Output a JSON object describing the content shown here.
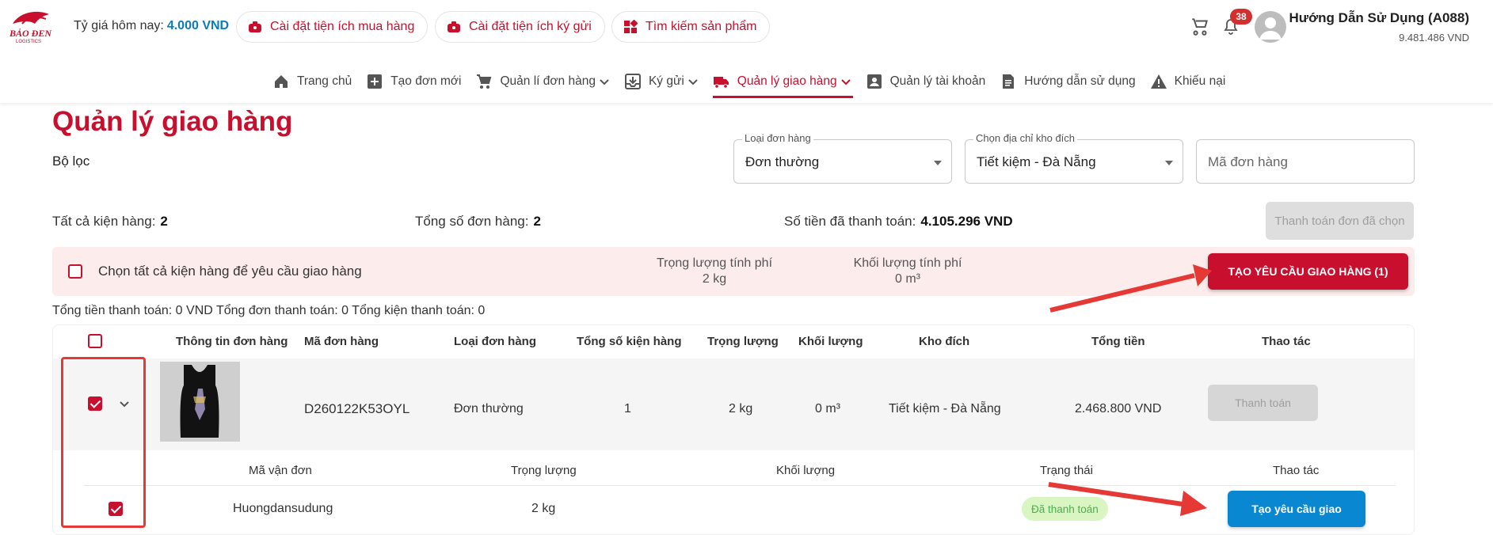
{
  "header": {
    "rate_label": "Tỷ giá hôm nay:",
    "rate_value": "4.000 VND",
    "pills": [
      {
        "label": "Cài đặt tiện ích mua hàng"
      },
      {
        "label": "Cài đặt tiện ích ký gửi"
      },
      {
        "label": "Tìm kiếm sản phẩm"
      }
    ],
    "notification_count": "38",
    "user_name": "Hướng Dẫn Sử Dụng (A088)",
    "user_balance": "9.481.486 VND"
  },
  "nav": [
    {
      "label": "Trang chủ",
      "icon": "home-icon"
    },
    {
      "label": "Tạo đơn mới",
      "icon": "plus-box-icon"
    },
    {
      "label": "Quản lí đơn hàng",
      "icon": "cart-icon"
    },
    {
      "label": "Ký gửi",
      "icon": "inbox-icon"
    },
    {
      "label": "Quản lý giao hàng",
      "icon": "truck-icon",
      "active": true
    },
    {
      "label": "Quản lý tài khoản",
      "icon": "account-box-icon"
    },
    {
      "label": "Hướng dẫn sử dụng",
      "icon": "document-icon"
    },
    {
      "label": "Khiếu nại",
      "icon": "warning-icon"
    }
  ],
  "page": {
    "title": "Quản lý giao hàng",
    "filter_label": "Bộ lọc"
  },
  "filters": {
    "order_type": {
      "legend": "Loại đơn hàng",
      "value": "Đơn thường"
    },
    "warehouse": {
      "legend": "Chọn địa chỉ kho đích",
      "value": "Tiết kiệm - Đà Nẵng"
    },
    "order_code": {
      "placeholder": "Mã đơn hàng"
    }
  },
  "summary": {
    "all_packages_label": "Tất cả kiện hàng:",
    "all_packages_value": "2",
    "total_orders_label": "Tổng số đơn hàng:",
    "total_orders_value": "2",
    "paid_amount_label": "Số tiền đã thanh toán:",
    "paid_amount_value": "4.105.296 VND",
    "pay_selected_button": "Thanh toán đơn đã chọn"
  },
  "select_bar": {
    "select_all_text": "Chọn tất cả kiện hàng để yêu cầu giao hàng",
    "charged_weight_label": "Trọng lượng tính phí",
    "charged_weight_value": "2 kg",
    "charged_volume_label": "Khối lượng tính phí",
    "charged_volume_value": "0 m³",
    "create_request_button": "TẠO YÊU CẦU GIAO HÀNG (1)"
  },
  "totals_line": "Tổng tiền thanh toán: 0 VND  Tổng đơn thanh toán: 0  Tổng kiện thanh toán: 0",
  "table": {
    "headers": [
      "Thông tin đơn hàng",
      "Mã đơn hàng",
      "Loại đơn hàng",
      "Tổng số kiện hàng",
      "Trọng lượng",
      "Khối lượng",
      "Kho đích",
      "Tổng tiền",
      "Thao tác"
    ],
    "row": {
      "order_code": "D260122K53OYL",
      "order_type": "Đơn thường",
      "package_count": "1",
      "weight": "2 kg",
      "volume": "0 m³",
      "warehouse": "Tiết kiệm - Đà Nẵng",
      "total": "2.468.800 VND",
      "pay_button": "Thanh toán"
    },
    "sub_headers": [
      "Mã vận đơn",
      "Trọng lượng",
      "Khối lượng",
      "Trạng thái",
      "Thao tác"
    ],
    "sub_row": {
      "tracking_code": "Huongdansudung",
      "weight": "2 kg",
      "status": "Đã thanh toán",
      "action_button": "Tạo yêu cầu giao"
    }
  },
  "colors": {
    "brand": "#c8102e",
    "accent_blue": "#0a87d1",
    "status_green": "#4caf50",
    "annotation_red": "#e53935"
  }
}
